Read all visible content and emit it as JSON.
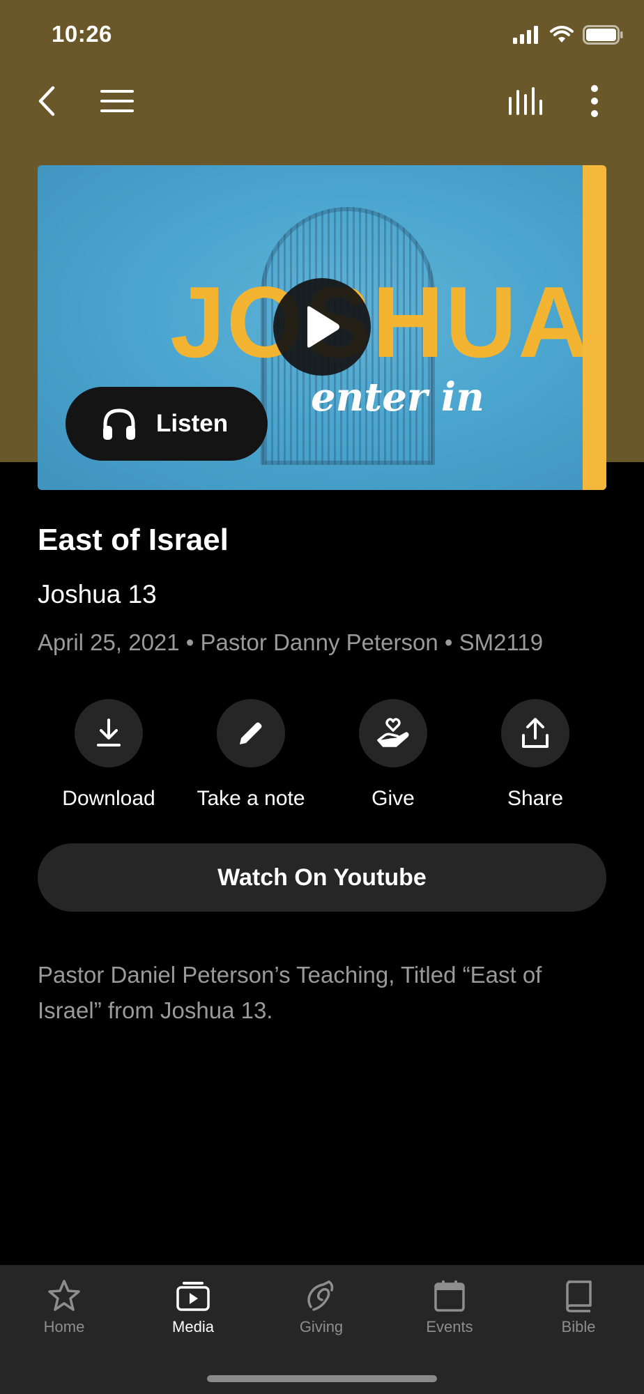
{
  "status_bar": {
    "time": "10:26"
  },
  "nav": {
    "back_icon": "chevron-left-icon",
    "menu_icon": "hamburger-menu-icon",
    "audio_icon": "audio-bars-icon",
    "more_icon": "more-vertical-icon"
  },
  "hero": {
    "artwork_title": "JOSHUA",
    "artwork_subtitle": "enter in",
    "listen_label": "Listen",
    "colors": {
      "artwork_bg": "#4ba6cf",
      "artwork_accent": "#f2b431",
      "header_bg": "#6b582a"
    }
  },
  "sermon": {
    "title": "East of Israel",
    "passage": "Joshua 13",
    "meta": "April 25, 2021 • Pastor Danny Peterson • SM2119",
    "description": "Pastor Daniel Peterson’s Teaching, Titled “East of Israel” from Joshua 13."
  },
  "actions": [
    {
      "label": "Download",
      "icon": "download-icon"
    },
    {
      "label": "Take a note",
      "icon": "pencil-icon"
    },
    {
      "label": "Give",
      "icon": "give-hand-heart-icon"
    },
    {
      "label": "Share",
      "icon": "share-icon"
    }
  ],
  "watch_button": {
    "label": "Watch On Youtube"
  },
  "tabs": [
    {
      "label": "Home",
      "icon": "star-icon",
      "active": false
    },
    {
      "label": "Media",
      "icon": "media-play-icon",
      "active": true
    },
    {
      "label": "Giving",
      "icon": "giving-icon",
      "active": false
    },
    {
      "label": "Events",
      "icon": "calendar-icon",
      "active": false
    },
    {
      "label": "Bible",
      "icon": "book-icon",
      "active": false
    }
  ]
}
